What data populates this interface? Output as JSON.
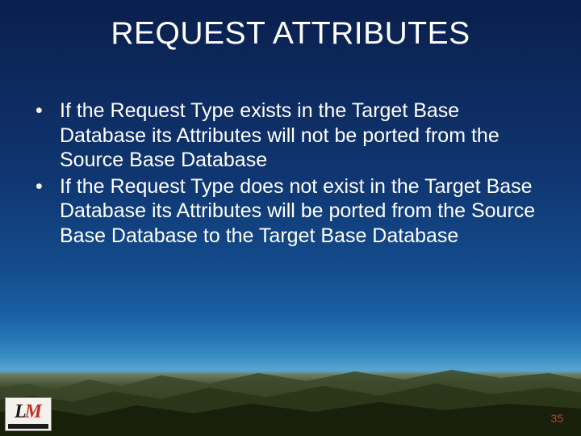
{
  "title": "REQUEST ATTRIBUTES",
  "bullets": [
    "If the Request Type exists in the Target Base Database its Attributes will not be ported from the Source Base Database",
    "If the Request Type does not exist in the Target Base Database its Attributes will be ported from the Source Base Database to the Target Base Database"
  ],
  "page_number": "35",
  "logo": {
    "letter1": "L",
    "letter2": "M"
  }
}
